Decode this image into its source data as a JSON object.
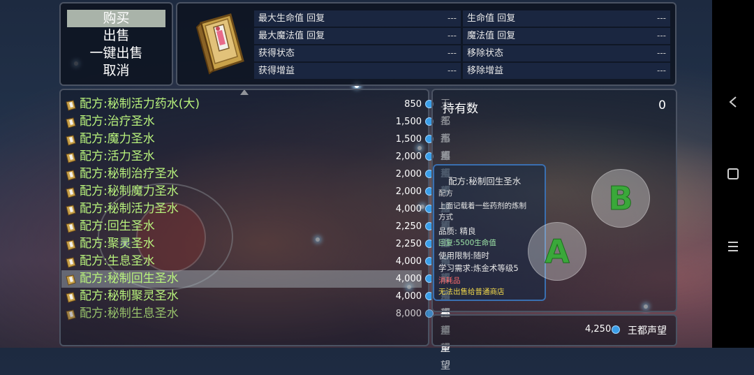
{
  "menu": {
    "items": [
      "购买",
      "出售",
      "一键出售",
      "取消"
    ],
    "selected_index": 0
  },
  "item_icon": "recipe-book-icon",
  "stats": {
    "left": [
      {
        "label": "最大生命值 回复",
        "value": "---"
      },
      {
        "label": "最大魔法值 回复",
        "value": "---"
      },
      {
        "label": "获得状态",
        "value": "---"
      },
      {
        "label": "获得增益",
        "value": "---"
      }
    ],
    "right": [
      {
        "label": "生命值 回复",
        "value": "---"
      },
      {
        "label": "魔法值 回复",
        "value": "---"
      },
      {
        "label": "移除状态",
        "value": "---"
      },
      {
        "label": "移除增益",
        "value": "---"
      }
    ]
  },
  "list": {
    "selected_index": 10,
    "items": [
      {
        "name": "配方:秘制活力药水(大)",
        "price": "850",
        "currency": "王都声望"
      },
      {
        "name": "配方:治疗圣水",
        "price": "1,500",
        "currency": "王都声望"
      },
      {
        "name": "配方:魔力圣水",
        "price": "1,500",
        "currency": "王都声望"
      },
      {
        "name": "配方:活力圣水",
        "price": "2,000",
        "currency": "王都声望"
      },
      {
        "name": "配方:秘制治疗圣水",
        "price": "2,000",
        "currency": "王都声望"
      },
      {
        "name": "配方:秘制魔力圣水",
        "price": "2,000",
        "currency": "王都声望"
      },
      {
        "name": "配方:秘制活力圣水",
        "price": "4,000",
        "currency": "王都声望"
      },
      {
        "name": "配方:回生圣水",
        "price": "2,250",
        "currency": "王都声望"
      },
      {
        "name": "配方:聚灵圣水",
        "price": "2,250",
        "currency": "王都声望"
      },
      {
        "name": "配方:生息圣水",
        "price": "4,000",
        "currency": "王都声望"
      },
      {
        "name": "配方:秘制回生圣水",
        "price": "4,000",
        "currency": "王都声望"
      },
      {
        "name": "配方:秘制聚灵圣水",
        "price": "4,000",
        "currency": "王都声望"
      },
      {
        "name": "配方:秘制生息圣水",
        "price": "8,000",
        "currency": "王都声望"
      }
    ]
  },
  "owned": {
    "label": "持有数",
    "value": "0"
  },
  "description": {
    "title": "配方:秘制回生圣水",
    "type": "配方",
    "text_line1": "上面记载着一些药剂的炼制",
    "text_line2": "方式",
    "quality": "品质: 精良",
    "effect": "回复:5500生命值",
    "limit": "使用限制:随时",
    "requirement": "学习需求:炼金术等级5",
    "consumable": "消耗品",
    "sell_note": "无法出售给普通商店"
  },
  "currency_total": {
    "value": "4,250",
    "label": "王都声望"
  },
  "buttons": {
    "a": "A",
    "b": "B"
  },
  "colors": {
    "accent_green": "#b8f27c",
    "panel_border": "#4b5363",
    "coin": "#3a9ee8",
    "consumable": "#ff6b6b",
    "sell_note": "#f2d94a"
  }
}
